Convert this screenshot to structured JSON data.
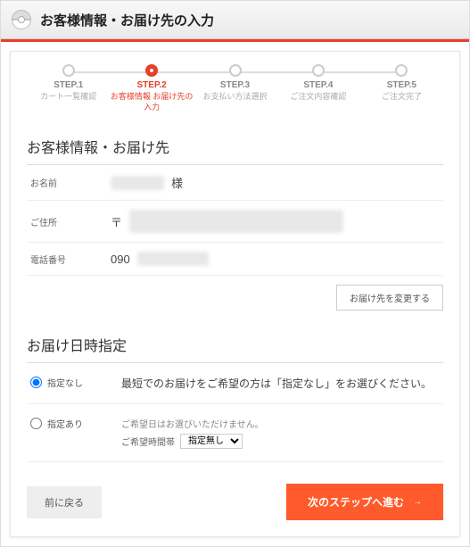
{
  "header": {
    "title": "お客様情報・お届け先の入力"
  },
  "steps": [
    {
      "title": "STEP.1",
      "sub": "カート一覧確認"
    },
    {
      "title": "STEP.2",
      "sub": "お客様情報\nお届け先の入力"
    },
    {
      "title": "STEP.3",
      "sub": "お支払い方法選択"
    },
    {
      "title": "STEP.4",
      "sub": "ご注文内容確認"
    },
    {
      "title": "STEP.5",
      "sub": "ご注文完了"
    }
  ],
  "active_step": 1,
  "customer": {
    "section_title": "お客様情報・お届け先",
    "name_label": "お名前",
    "name_suffix": "様",
    "address_label": "ご住所",
    "address_prefix": "〒",
    "phone_label": "電話番号",
    "phone_prefix": "090",
    "change_button": "お届け先を変更する"
  },
  "delivery": {
    "section_title": "お届け日時指定",
    "option_none": "指定なし",
    "option_none_desc": "最短でのお届けをご希望の方は「指定なし」をお選びください。",
    "option_set": "指定あり",
    "option_set_note": "ご希望日はお選びいただけません。",
    "time_label": "ご希望時間帯",
    "time_value": "指定無し",
    "selected": "none"
  },
  "buttons": {
    "back": "前に戻る",
    "next": "次のステップへ進む"
  }
}
